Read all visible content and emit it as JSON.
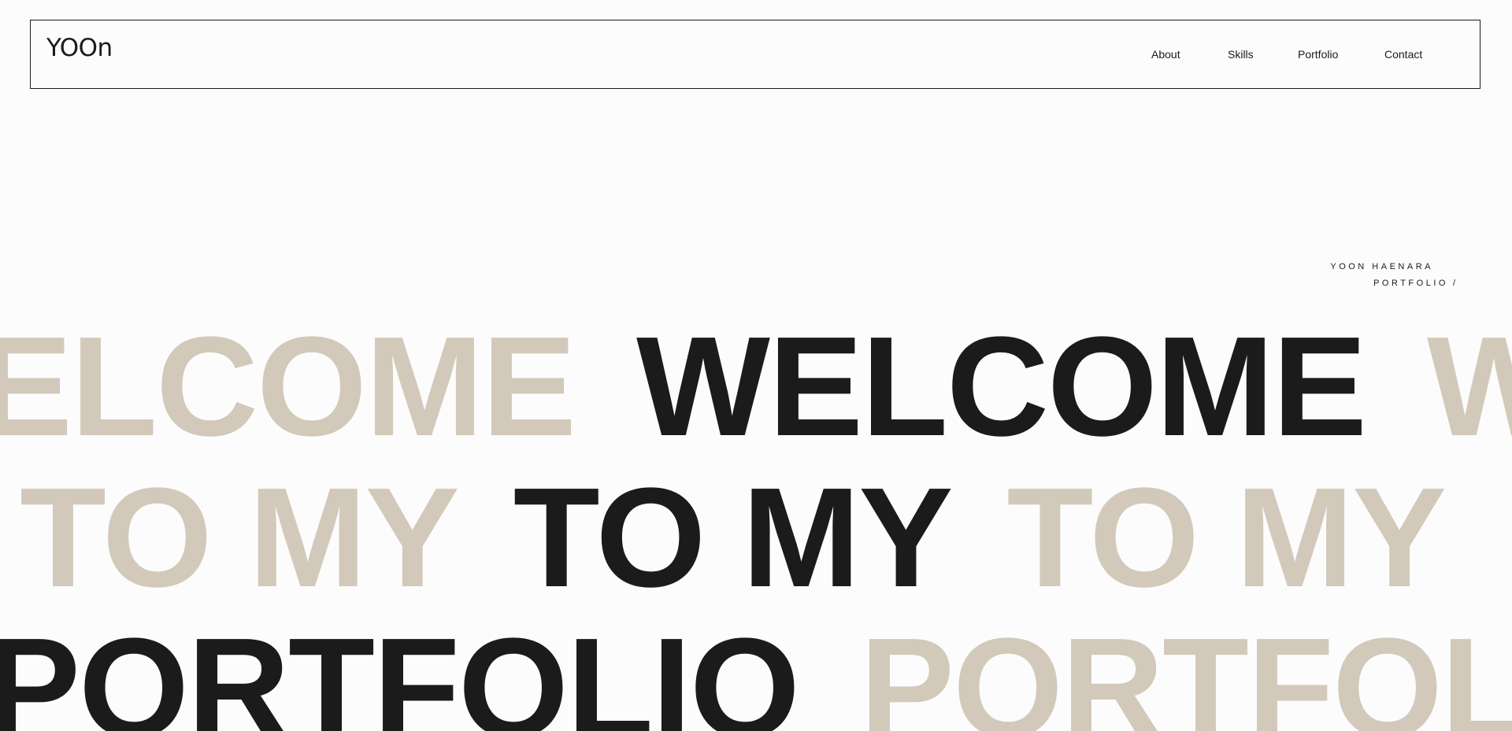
{
  "header": {
    "logo": "YOOn",
    "nav": [
      {
        "label": "About"
      },
      {
        "label": "Skills"
      },
      {
        "label": "Portfolio"
      },
      {
        "label": "Contact"
      }
    ]
  },
  "hero": {
    "tagline_line1": "YOON HAENARA",
    "tagline_line2": "PORTFOLIO",
    "tagline_slash": "/",
    "rows": [
      {
        "ghost_before": "ELCOME",
        "solid": "WELCOME",
        "ghost_after": "WELCOME"
      },
      {
        "ghost_before": "TO MY",
        "solid": "TO MY",
        "ghost_after": "TO MY"
      },
      {
        "solid_before": "PORTFOLIO",
        "ghost_after": "PORTFOLIO"
      }
    ]
  },
  "colors": {
    "background": "#fcfcfc",
    "text": "#1c1b1c",
    "ghost_text": "#d2c9bb"
  }
}
